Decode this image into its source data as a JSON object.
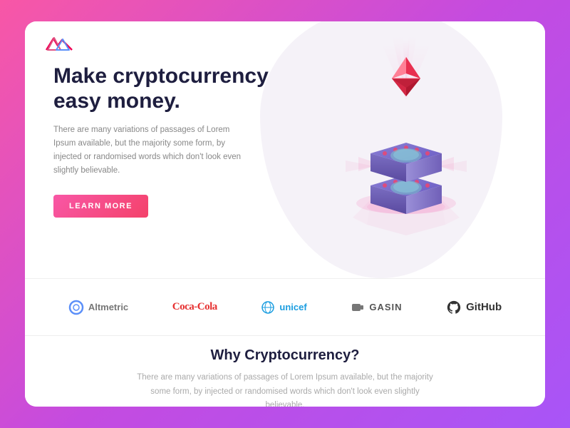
{
  "brand": {
    "logo_alt": "Brand Logo"
  },
  "hero": {
    "title": "Make cryptocurrency easy money.",
    "description": "There are many variations of passages of Lorem Ipsum available, but the majority some form, by injected or randomised words which don't look even slightly believable.",
    "cta_label": "LEARN MORE"
  },
  "partners": [
    {
      "name": "Altmetric",
      "icon": "circle-icon"
    },
    {
      "name": "Coca-Cola",
      "icon": "cola-icon"
    },
    {
      "name": "unicef",
      "icon": "unicef-icon"
    },
    {
      "name": "GASIN",
      "icon": "gasin-icon"
    },
    {
      "name": "GitHub",
      "icon": "github-icon"
    }
  ],
  "why": {
    "title": "Why Cryptocurrency?",
    "description": "There are many variations of passages of Lorem Ipsum available, but the majority some form, by injected or randomised words which don't look even slightly believable."
  },
  "colors": {
    "accent": "#f4426a",
    "title": "#1e1e3f",
    "muted": "#999999",
    "bg_blob": "#f5f2f8"
  }
}
